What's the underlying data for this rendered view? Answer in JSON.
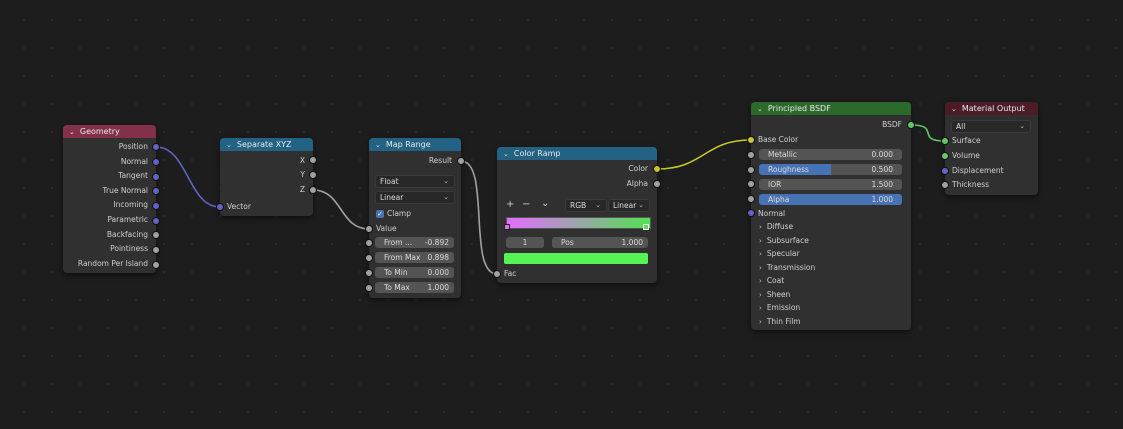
{
  "nodes": {
    "geometry": {
      "title": "Geometry",
      "outputs": [
        "Position",
        "Normal",
        "Tangent",
        "True Normal",
        "Incoming",
        "Parametric",
        "Backfacing",
        "Pointiness",
        "Random Per Island"
      ]
    },
    "separate_xyz": {
      "title": "Separate XYZ",
      "outputs": [
        "X",
        "Y",
        "Z"
      ],
      "input": "Vector"
    },
    "map_range": {
      "title": "Map Range",
      "output": "Result",
      "data_type": "Float",
      "interpolation": "Linear",
      "clamp_label": "Clamp",
      "value_label": "Value",
      "fields": [
        {
          "label": "From ...",
          "value": "-0.892"
        },
        {
          "label": "From Max",
          "value": "0.898"
        },
        {
          "label": "To Min",
          "value": "0.000"
        },
        {
          "label": "To Max",
          "value": "1.000"
        }
      ]
    },
    "color_ramp": {
      "title": "Color Ramp",
      "outputs": [
        "Color",
        "Alpha"
      ],
      "add_icon": "+",
      "remove_icon": "−",
      "menu_icon": "⌄",
      "color_mode": "RGB",
      "interpolation": "Linear",
      "stop_index": "1",
      "pos_label": "Pos",
      "pos_value": "1.000",
      "gradient_start": "#e46dff",
      "gradient_end": "#52e052",
      "stop_color": "#56f256",
      "input": "Fac"
    },
    "principled_bsdf": {
      "title": "Principled BSDF",
      "output": "BSDF",
      "base_color_label": "Base Color",
      "fields": [
        {
          "label": "Metallic",
          "value": "0.000",
          "fill": 0.0
        },
        {
          "label": "Roughness",
          "value": "0.500",
          "fill": 0.5
        },
        {
          "label": "IOR",
          "value": "1.500",
          "fill": 0.0
        },
        {
          "label": "Alpha",
          "value": "1.000",
          "fill": 1.0
        }
      ],
      "normal_label": "Normal",
      "panels": [
        "Diffuse",
        "Subsurface",
        "Specular",
        "Transmission",
        "Coat",
        "Sheen",
        "Emission",
        "Thin Film"
      ]
    },
    "material_output": {
      "title": "Material Output",
      "target": "All",
      "inputs": [
        "Surface",
        "Volume",
        "Displacement",
        "Thickness"
      ]
    }
  },
  "colors": {
    "geometry_header": "#83314a",
    "converter_header": "#246283",
    "shader_header": "#2c6a2b",
    "output_header": "#4c1d27",
    "wire_vector": "#6363c7",
    "wire_float": "#a1a1a1",
    "wire_color": "#c7c729",
    "wire_shader": "#63c763"
  }
}
